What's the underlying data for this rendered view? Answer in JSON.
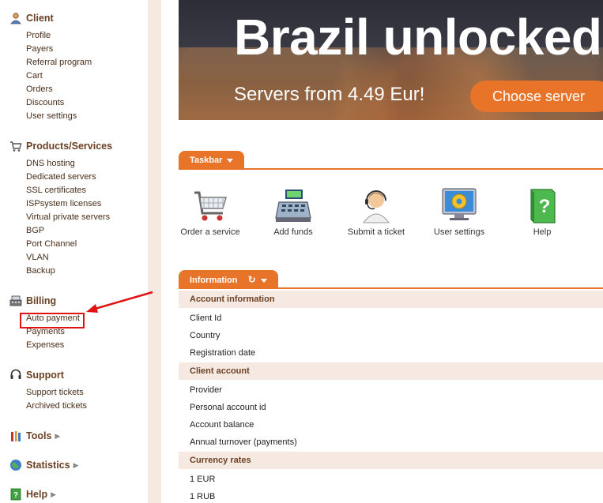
{
  "sidebar": {
    "client": {
      "title": "Client",
      "items": [
        "Profile",
        "Payers",
        "Referral program",
        "Cart",
        "Orders",
        "Discounts",
        "User settings"
      ]
    },
    "products": {
      "title": "Products/Services",
      "items": [
        "DNS hosting",
        "Dedicated servers",
        "SSL certificates",
        "ISPsystem licenses",
        "Virtual private servers",
        "BGP",
        "Port Channel",
        "VLAN",
        "Backup"
      ]
    },
    "billing": {
      "title": "Billing",
      "items": [
        "Auto payment",
        "Payments",
        "Expenses"
      ]
    },
    "support": {
      "title": "Support",
      "items": [
        "Support tickets",
        "Archived tickets"
      ]
    },
    "tools": {
      "title": "Tools"
    },
    "statistics": {
      "title": "Statistics"
    },
    "help": {
      "title": "Help"
    }
  },
  "banner": {
    "title": "Brazil unlocked",
    "subtitle": "Servers from 4.49 Eur!",
    "button": "Choose server"
  },
  "taskbar": {
    "tab_label": "Taskbar",
    "items": [
      {
        "label": "Order a service",
        "icon": "shopping-cart-icon"
      },
      {
        "label": "Add funds",
        "icon": "cash-register-icon"
      },
      {
        "label": "Submit a ticket",
        "icon": "support-agent-icon"
      },
      {
        "label": "User settings",
        "icon": "settings-monitor-icon"
      },
      {
        "label": "Help",
        "icon": "help-book-icon"
      }
    ]
  },
  "information": {
    "tab_label": "Information",
    "sections": [
      {
        "title": "Account information",
        "rows": [
          "Client Id",
          "Country",
          "Registration date"
        ]
      },
      {
        "title": "Client account",
        "rows": [
          "Provider",
          "Personal account id",
          "Account balance",
          "Annual turnover (payments)"
        ]
      },
      {
        "title": "Currency rates",
        "rows": [
          "1 EUR",
          "1 RUB"
        ]
      }
    ]
  },
  "colors": {
    "accent": "#e8742a",
    "section_text": "#6b4024",
    "header_bg": "#f6e9e1",
    "highlight": "#e01212"
  }
}
